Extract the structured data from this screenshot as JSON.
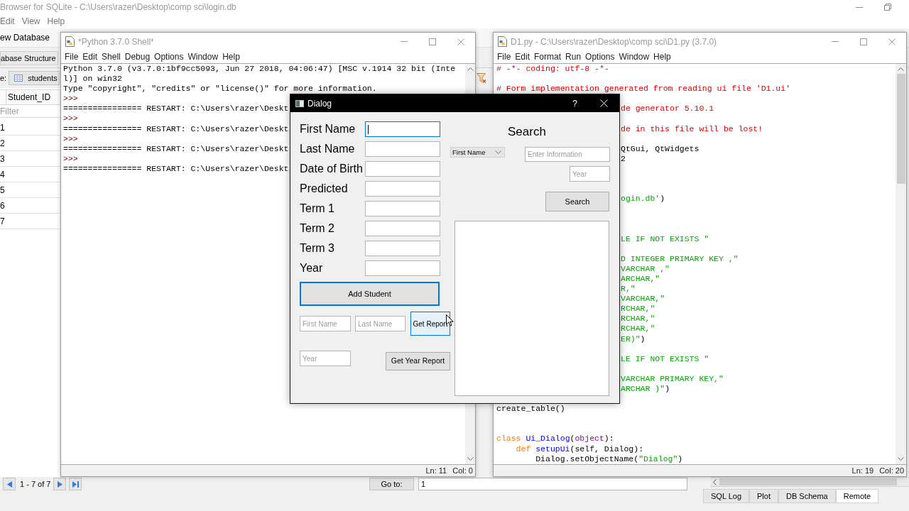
{
  "db_browser": {
    "title": "Browser for SQLite - C:\\Users\\razer\\Desktop\\comp sci\\login.db",
    "menu": [
      "Edit",
      "View",
      "Help"
    ],
    "toolbar": [
      "ew Database"
    ],
    "tabs": [
      {
        "label": "abase Structure",
        "selected": false
      }
    ],
    "table_label": "e:",
    "table_select": "students",
    "table": {
      "columns": [
        "Student_ID"
      ],
      "filter_placeholder": "Filter",
      "rows": [
        "1",
        "2",
        "3",
        "4",
        "5",
        "6",
        "7"
      ]
    },
    "pager": {
      "range": "1 - 7 of 7",
      "goto_button": "Go to:",
      "goto_value": "1"
    },
    "dock_tabs": [
      {
        "label": "SQL Log",
        "selected": false
      },
      {
        "label": "Plot",
        "selected": false
      },
      {
        "label": "DB Schema",
        "selected": false
      },
      {
        "label": "Remote",
        "selected": true
      }
    ]
  },
  "shell_window": {
    "title": "*Python 3.7.0 Shell*",
    "menu": [
      "File",
      "Edit",
      "Shell",
      "Debug",
      "Options",
      "Window",
      "Help"
    ],
    "lines": [
      {
        "kind": "output",
        "text": "Python 3.7.0 (v3.7.0:1bf9cc5093, Jun 27 2018, 04:06:47) [MSC v.1914 32 bit (Inte"
      },
      {
        "kind": "output",
        "text": "l)] on win32"
      },
      {
        "kind": "output",
        "text": "Type \"copyright\", \"credits\" or \"license()\" for more information."
      },
      {
        "kind": "prompt",
        "text": ">>>"
      },
      {
        "kind": "output",
        "text": "================ RESTART: C:\\Users\\razer\\Deskt"
      },
      {
        "kind": "prompt",
        "text": ">>>"
      },
      {
        "kind": "output",
        "text": "================ RESTART: C:\\Users\\razer\\Deskt"
      },
      {
        "kind": "prompt",
        "text": ">>>"
      },
      {
        "kind": "output",
        "text": "================ RESTART: C:\\Users\\razer\\Deskt"
      },
      {
        "kind": "prompt",
        "text": ">>>"
      },
      {
        "kind": "output",
        "text": "================ RESTART: C:\\Users\\razer\\Deskt"
      }
    ],
    "status": [
      "Ln: 11",
      "Col: 0"
    ]
  },
  "editor_window": {
    "title": "D1.py - C:\\Users\\razer\\Desktop\\comp sci\\D1.py (3.7.0)",
    "menu": [
      "File",
      "Edit",
      "Format",
      "Run",
      "Options",
      "Window",
      "Help"
    ],
    "lines": [
      {
        "kind": "full",
        "segments": [
          {
            "kind": "comment",
            "text": "# -*- coding: utf-8 -*-"
          }
        ]
      },
      {
        "kind": "blank"
      },
      {
        "kind": "full",
        "segments": [
          {
            "kind": "comment",
            "text": "# Form implementation generated from reading ui file 'D1.ui'"
          }
        ]
      },
      {
        "kind": "blank"
      },
      {
        "kind": "clipped",
        "segments": [
          {
            "kind": "comment",
            "text": "de generator 5.10.1"
          }
        ]
      },
      {
        "kind": "blank"
      },
      {
        "kind": "clipped",
        "segments": [
          {
            "kind": "comment",
            "text": "de in this file will be lost!"
          }
        ]
      },
      {
        "kind": "blank"
      },
      {
        "kind": "clipped",
        "segments": [
          {
            "kind": "plain",
            "text": "QtGui, QtWidgets"
          }
        ]
      },
      {
        "kind": "clipped",
        "segments": [
          {
            "kind": "plain",
            "text": "2"
          }
        ]
      },
      {
        "kind": "blank"
      },
      {
        "kind": "blank"
      },
      {
        "kind": "blank"
      },
      {
        "kind": "clipped",
        "segments": [
          {
            "kind": "string",
            "text": "ogin.db'"
          },
          {
            "kind": "plain",
            "text": ")"
          }
        ]
      },
      {
        "kind": "blank"
      },
      {
        "kind": "blank"
      },
      {
        "kind": "blank"
      },
      {
        "kind": "clipped",
        "segments": [
          {
            "kind": "string",
            "text": "LE IF NOT EXISTS \""
          }
        ]
      },
      {
        "kind": "blank"
      },
      {
        "kind": "clipped",
        "segments": [
          {
            "kind": "string",
            "text": "D INTEGER PRIMARY KEY ,\""
          }
        ]
      },
      {
        "kind": "clipped",
        "segments": [
          {
            "kind": "string",
            "text": "VARCHAR ,\""
          }
        ]
      },
      {
        "kind": "clipped",
        "segments": [
          {
            "kind": "string",
            "text": "ARCHAR,\""
          }
        ]
      },
      {
        "kind": "clipped",
        "segments": [
          {
            "kind": "string",
            "text": "R,\""
          }
        ]
      },
      {
        "kind": "clipped",
        "segments": [
          {
            "kind": "string",
            "text": "VARCHAR,\""
          }
        ]
      },
      {
        "kind": "clipped",
        "segments": [
          {
            "kind": "string",
            "text": "RCHAR,\""
          }
        ]
      },
      {
        "kind": "clipped",
        "segments": [
          {
            "kind": "string",
            "text": "RCHAR,\""
          }
        ]
      },
      {
        "kind": "clipped",
        "segments": [
          {
            "kind": "string",
            "text": "RCHAR,\""
          }
        ]
      },
      {
        "kind": "clipped",
        "segments": [
          {
            "kind": "string",
            "text": "ER)\""
          },
          {
            "kind": "plain",
            "text": ")"
          }
        ]
      },
      {
        "kind": "blank"
      },
      {
        "kind": "clipped",
        "segments": [
          {
            "kind": "string",
            "text": "LE IF NOT EXISTS \""
          }
        ]
      },
      {
        "kind": "blank"
      },
      {
        "kind": "clipped",
        "segments": [
          {
            "kind": "string",
            "text": "VARCHAR PRIMARY KEY,\""
          }
        ]
      },
      {
        "kind": "clipped",
        "segments": [
          {
            "kind": "string",
            "text": "ARCHAR )\""
          },
          {
            "kind": "plain",
            "text": ")"
          }
        ]
      },
      {
        "kind": "blank"
      },
      {
        "kind": "full",
        "segments": [
          {
            "kind": "plain",
            "text": "create_table()"
          }
        ]
      },
      {
        "kind": "blank"
      },
      {
        "kind": "blank"
      },
      {
        "kind": "full",
        "segments": [
          {
            "kind": "keyword",
            "text": "class"
          },
          {
            "kind": "definition",
            "text": " Ui_Dialog"
          },
          {
            "kind": "plain",
            "text": "("
          },
          {
            "kind": "builtin",
            "text": "object"
          },
          {
            "kind": "plain",
            "text": "):"
          }
        ]
      },
      {
        "kind": "full",
        "segments": [
          {
            "kind": "keyword",
            "text": "    def"
          },
          {
            "kind": "definition",
            "text": " setupUi"
          },
          {
            "kind": "plain",
            "text": "(self, Dialog):"
          }
        ]
      },
      {
        "kind": "full",
        "segments": [
          {
            "kind": "plain",
            "text": "        Dialog.setObjectName("
          },
          {
            "kind": "string",
            "text": "\"Dialog\""
          },
          {
            "kind": "plain",
            "text": ")"
          }
        ]
      }
    ],
    "status": [
      "Ln: 19",
      "Col: 20"
    ]
  },
  "dialog": {
    "title": "Dialog",
    "help": "?",
    "fields": [
      {
        "label": "First Name",
        "focused": true
      },
      {
        "label": "Last Name",
        "focused": false
      },
      {
        "label": "Date of Birth",
        "focused": false
      },
      {
        "label": "Predicted",
        "focused": false
      },
      {
        "label": "Term 1",
        "focused": false
      },
      {
        "label": "Term 2",
        "focused": false
      },
      {
        "label": "Term 3",
        "focused": false
      },
      {
        "label": "Year",
        "focused": false
      }
    ],
    "add_button": {
      "label": "Add Student",
      "focused": true
    },
    "report": {
      "first_name_placeholder": "First Name",
      "last_name_placeholder": "Last Name",
      "button": {
        "label": "Get Report",
        "hovered": true
      }
    },
    "year_report": {
      "year_placeholder": "Year",
      "button": "Get Year Report"
    },
    "search": {
      "heading": "Search",
      "field_select": "First Name",
      "query_placeholder": "Enter Information",
      "year_placeholder": "Year",
      "button": "Search"
    }
  }
}
